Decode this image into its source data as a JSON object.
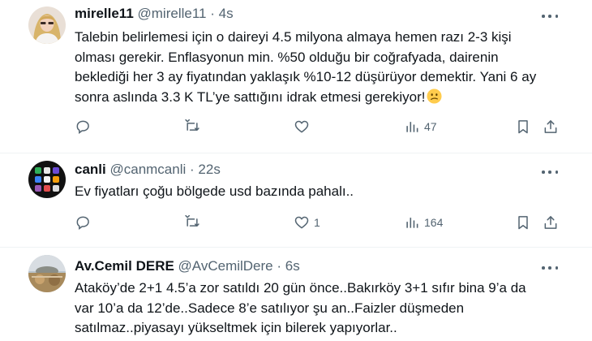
{
  "tweets": [
    {
      "name": "mirelle11",
      "handle": "@mirelle11",
      "sep": "·",
      "time": "4s",
      "lines": [
        "Talebin belirlemesi için o daireyi 4.5 milyona almaya hemen razı 2-3 kişi",
        "olması gerekir. Enflasyonun min. %50 olduğu bir coğrafyada, dairenin",
        "beklediği her 3 ay fiyatından yaklaşık %10-12 düşürüyor demektir. Yani 6 ay",
        "sonra aslında 3.3 K TL’ye sattığını idrak etmesi gerekiyor!"
      ],
      "emoji_icon": "confused-face-emoji",
      "likes": "",
      "views": "47"
    },
    {
      "name": "canli",
      "handle": "@canmcanli",
      "sep": "·",
      "time": "22s",
      "lines": [
        "Ev fiyatları çoğu bölgede usd bazında pahalı.."
      ],
      "likes": "1",
      "views": "164"
    },
    {
      "name": "Av.Cemil DERE",
      "handle": "@AvCemilDere",
      "sep": "·",
      "time": "6s",
      "lines": [
        "Ataköy’de 2+1 4.5’a zor satıldı 20 gün önce..Bakırköy 3+1 sıfır bina 9’a da",
        "var 10’a da 12’de..Sadece 8’e satılıyor şu an..Faizler düşmeden",
        "satılmaz..piyasayı yükseltmek için bilerek yapıyorlar.."
      ]
    }
  ],
  "colors": {
    "text": "#0f1419",
    "secondary": "#536471",
    "divider": "#eff3f4"
  }
}
